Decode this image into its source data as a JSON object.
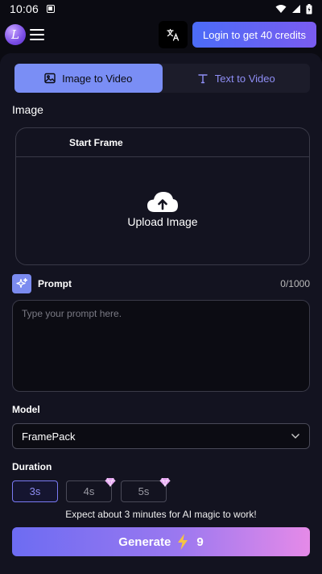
{
  "status": {
    "time": "10:06"
  },
  "header": {
    "logo_letter": "L",
    "login_label": "Login to get 40 credits"
  },
  "tabs": [
    {
      "label": "Image to Video",
      "active": true
    },
    {
      "label": "Text to Video",
      "active": false
    }
  ],
  "image_section": {
    "label": "Image",
    "frame_label": "Start Frame",
    "upload_label": "Upload Image"
  },
  "prompt": {
    "label": "Prompt",
    "counter": "0/1000",
    "placeholder": "Type your prompt here.",
    "value": ""
  },
  "model": {
    "label": "Model",
    "selected": "FramePack"
  },
  "duration": {
    "label": "Duration",
    "options": [
      {
        "label": "3s",
        "selected": true,
        "premium": false
      },
      {
        "label": "4s",
        "selected": false,
        "premium": true
      },
      {
        "label": "5s",
        "selected": false,
        "premium": true
      }
    ]
  },
  "hint": "Expect about 3 minutes for AI magic to work!",
  "generate": {
    "label": "Generate",
    "cost": "9"
  },
  "colors": {
    "accent": "#7a8ef5",
    "background": "#0b0b12",
    "panel": "#131320"
  }
}
